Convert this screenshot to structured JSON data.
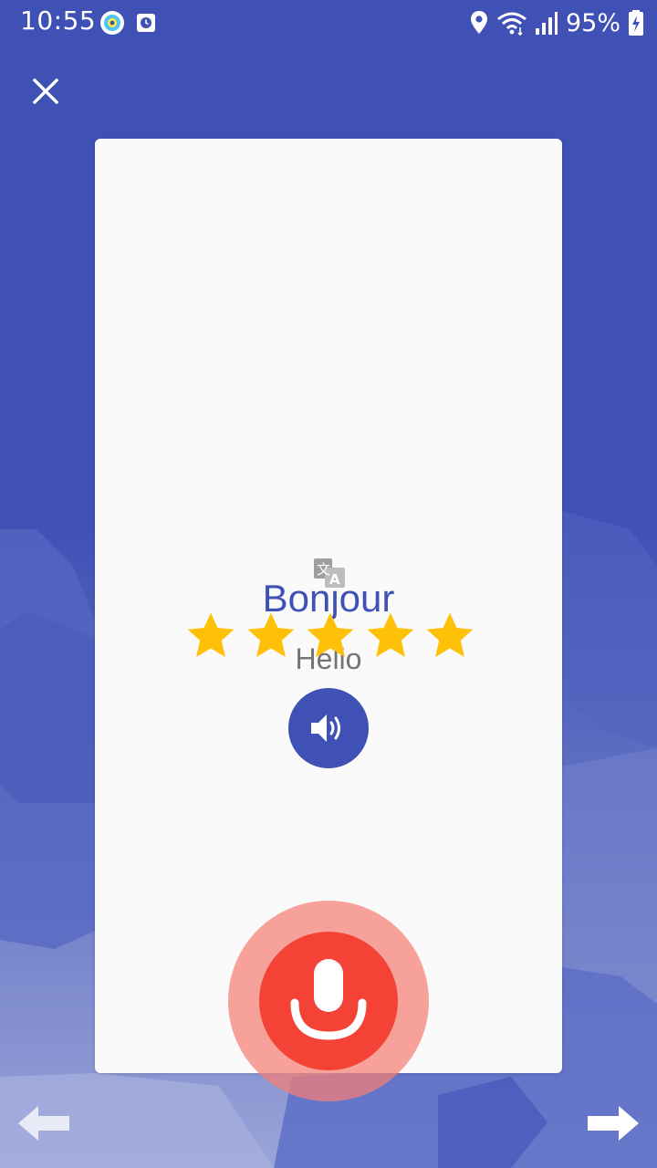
{
  "status_bar": {
    "time": "10:55",
    "battery_percent": "95%",
    "icons": [
      "mail-app-icon",
      "clock-app-icon",
      "location-icon",
      "wifi-icon",
      "signal-icon",
      "battery-charging-icon"
    ]
  },
  "card": {
    "word": "Bonjour",
    "translation": "Hello",
    "rating": 5,
    "rating_max": 5
  },
  "colors": {
    "primary": "#3f51b5",
    "mic": "#f44336",
    "star": "#ffc107",
    "translation_text": "#757575"
  },
  "icons": {
    "close": "close-icon",
    "translate": "translate-icon",
    "speaker": "speaker-icon",
    "mic": "microphone-icon",
    "prev": "arrow-left-icon",
    "next": "arrow-right-icon"
  }
}
